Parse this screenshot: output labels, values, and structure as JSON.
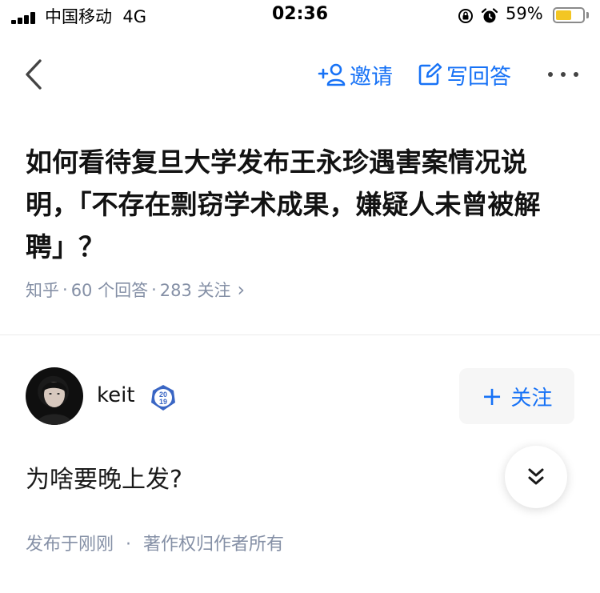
{
  "status_bar": {
    "carrier": "中国移动",
    "network": "4G",
    "time": "02:36",
    "battery_percent": "59%",
    "battery_level": 0.59,
    "icons": [
      "signal-icon",
      "lock-rotation-icon",
      "alarm-icon",
      "battery-icon"
    ]
  },
  "nav": {
    "back_icon": "chevron-left-icon",
    "invite_label": "邀请",
    "write_answer_label": "写回答",
    "more_icon": "more-horizontal-icon"
  },
  "question": {
    "title": "如何看待复旦大学发布王永珍遇害案情况说明，「不存在剽窃学术成果，嫌疑人未曾被解聘」？",
    "source": "知乎",
    "answers": "60 个回答",
    "followers": "283 关注",
    "meta_arrow": "›",
    "separator": "·"
  },
  "answer": {
    "author": "keit",
    "badge_text_top": "20",
    "badge_text_bottom": "19",
    "follow_label": "关注",
    "follow_plus": "+",
    "content": "为啥要晚上发?",
    "published": "发布于刚刚",
    "meta_separator": "·",
    "copyright": "著作权归作者所有"
  },
  "colors": {
    "accent": "#1772f6",
    "meta_text": "#8590a6",
    "title_text": "#121212",
    "battery": "#f3c623"
  }
}
